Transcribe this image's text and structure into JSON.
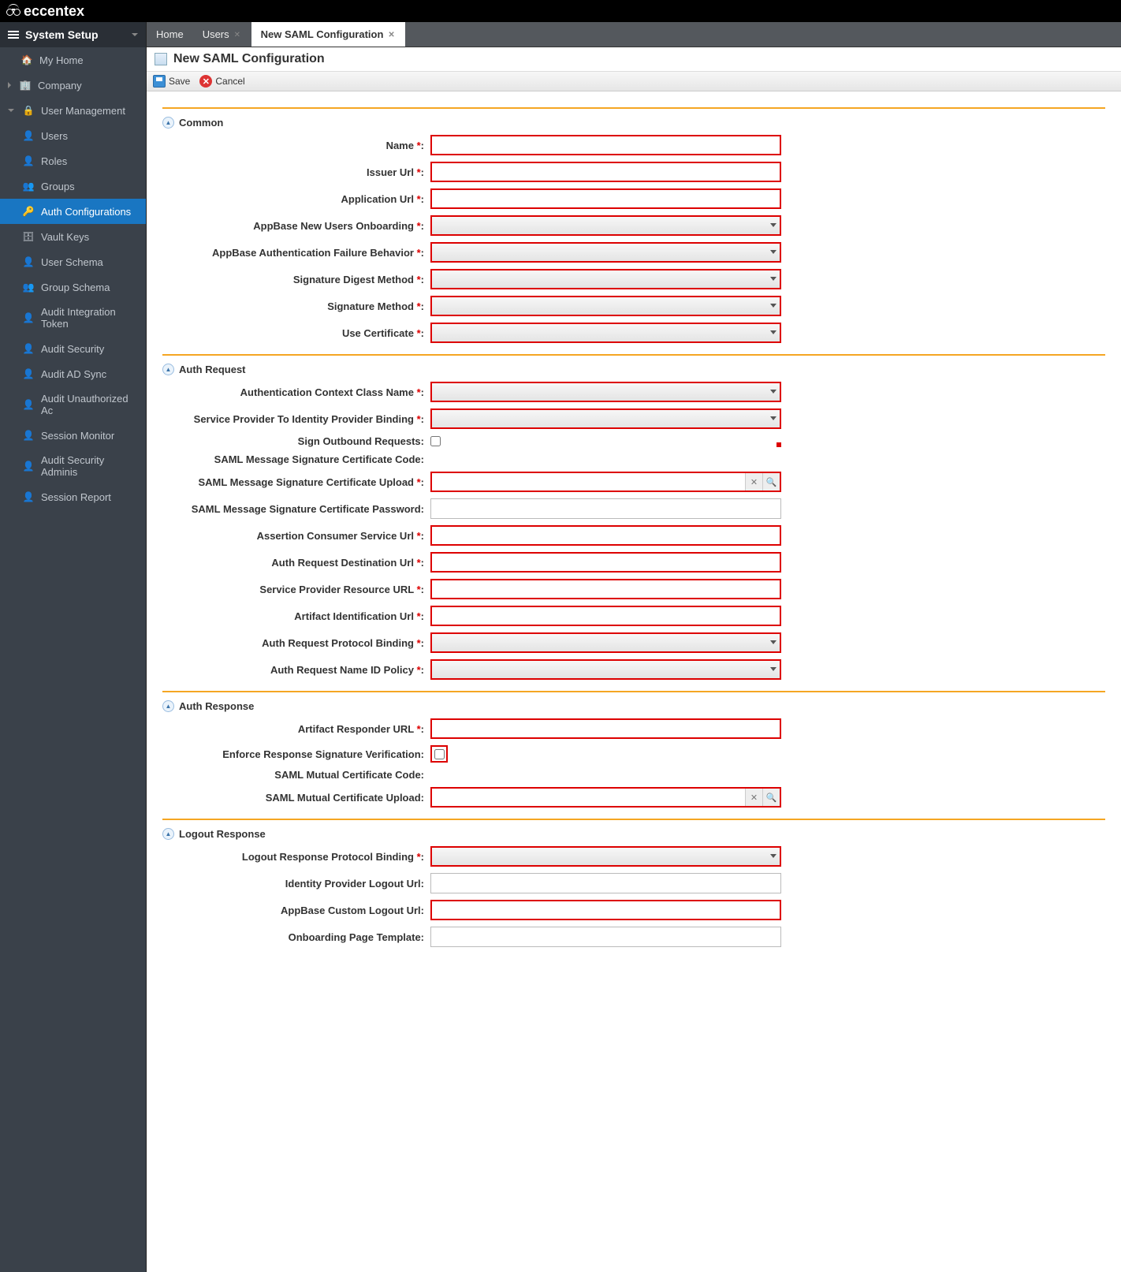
{
  "brand": {
    "name": "eccentex"
  },
  "sidebar": {
    "header": "System Setup",
    "items": [
      {
        "label": "My Home",
        "icon": "home",
        "level": 0
      },
      {
        "label": "Company",
        "icon": "company",
        "level": 0,
        "expandable": true
      },
      {
        "label": "User Management",
        "icon": "lock",
        "level": 0,
        "expandable": true,
        "open": true
      },
      {
        "label": "Users",
        "icon": "user",
        "level": 1
      },
      {
        "label": "Roles",
        "icon": "user",
        "level": 1
      },
      {
        "label": "Groups",
        "icon": "users",
        "level": 1
      },
      {
        "label": "Auth Configurations",
        "icon": "key",
        "level": 1,
        "active": true
      },
      {
        "label": "Vault Keys",
        "icon": "vault",
        "level": 1
      },
      {
        "label": "User Schema",
        "icon": "user",
        "level": 1
      },
      {
        "label": "Group Schema",
        "icon": "users",
        "level": 1
      },
      {
        "label": "Audit Integration Token",
        "icon": "user",
        "level": 1
      },
      {
        "label": "Audit Security",
        "icon": "user",
        "level": 1
      },
      {
        "label": "Audit AD Sync",
        "icon": "user",
        "level": 1
      },
      {
        "label": "Audit Unauthorized Ac",
        "icon": "user",
        "level": 1
      },
      {
        "label": "Session Monitor",
        "icon": "user",
        "level": 1
      },
      {
        "label": "Audit Security Adminis",
        "icon": "user",
        "level": 1
      },
      {
        "label": "Session Report",
        "icon": "user",
        "level": 1
      }
    ]
  },
  "tabs": [
    {
      "label": "Home",
      "closable": false
    },
    {
      "label": "Users",
      "closable": true
    },
    {
      "label": "New SAML Configuration",
      "closable": true,
      "active": true
    }
  ],
  "page": {
    "title": "New SAML Configuration"
  },
  "toolbar": {
    "save": "Save",
    "cancel": "Cancel"
  },
  "sections": {
    "common": {
      "title": "Common",
      "fields": [
        {
          "key": "name",
          "label": "Name",
          "req": true,
          "type": "text"
        },
        {
          "key": "issuer_url",
          "label": "Issuer Url",
          "req": true,
          "type": "text"
        },
        {
          "key": "application_url",
          "label": "Application Url",
          "req": true,
          "type": "text"
        },
        {
          "key": "onboarding",
          "label": "AppBase New Users Onboarding",
          "req": true,
          "type": "select"
        },
        {
          "key": "auth_fail",
          "label": "AppBase Authentication Failure Behavior",
          "req": true,
          "type": "select"
        },
        {
          "key": "sig_digest",
          "label": "Signature Digest Method",
          "req": true,
          "type": "select"
        },
        {
          "key": "sig_method",
          "label": "Signature Method",
          "req": true,
          "type": "select"
        },
        {
          "key": "use_cert",
          "label": "Use Certificate",
          "req": true,
          "type": "select"
        }
      ]
    },
    "auth_request": {
      "title": "Auth Request",
      "fields": [
        {
          "key": "ctx_class",
          "label": "Authentication Context Class Name",
          "req": true,
          "type": "select"
        },
        {
          "key": "sp_idp_binding",
          "label": "Service Provider To Identity Provider Binding",
          "req": true,
          "type": "select"
        },
        {
          "key": "sign_outbound",
          "label": "Sign Outbound Requests:",
          "req": false,
          "type": "checkbox_plain",
          "trail_red": true
        },
        {
          "key": "sig_cert_code",
          "label": "SAML Message Signature Certificate Code:",
          "req": false,
          "type": "static"
        },
        {
          "key": "sig_cert_upload",
          "label": "SAML Message Signature Certificate Upload",
          "req": true,
          "type": "upload"
        },
        {
          "key": "sig_cert_pw",
          "label": "SAML Message Signature Certificate Password:",
          "req": false,
          "type": "text_plain"
        },
        {
          "key": "acs_url",
          "label": "Assertion Consumer Service Url",
          "req": true,
          "type": "text"
        },
        {
          "key": "dest_url",
          "label": "Auth Request Destination Url",
          "req": true,
          "type": "text"
        },
        {
          "key": "sp_res_url",
          "label": "Service Provider Resource URL",
          "req": true,
          "type": "text"
        },
        {
          "key": "artifact_id_url",
          "label": "Artifact Identification Url",
          "req": true,
          "type": "text"
        },
        {
          "key": "protocol_binding",
          "label": "Auth Request Protocol Binding",
          "req": true,
          "type": "select"
        },
        {
          "key": "nameid_policy",
          "label": "Auth Request Name ID Policy",
          "req": true,
          "type": "select"
        }
      ]
    },
    "auth_response": {
      "title": "Auth Response",
      "fields": [
        {
          "key": "artifact_responder",
          "label": "Artifact Responder URL",
          "req": true,
          "type": "text"
        },
        {
          "key": "enforce_sig",
          "label": "Enforce Response Signature Verification:",
          "req": false,
          "type": "checkbox_boxed"
        },
        {
          "key": "mutual_cert_code",
          "label": "SAML Mutual Certificate Code:",
          "req": false,
          "type": "static"
        },
        {
          "key": "mutual_cert_upload",
          "label": "SAML Mutual Certificate Upload:",
          "req": false,
          "type": "upload"
        }
      ]
    },
    "logout_response": {
      "title": "Logout Response",
      "fields": [
        {
          "key": "logout_binding",
          "label": "Logout Response Protocol Binding",
          "req": true,
          "type": "select"
        },
        {
          "key": "idp_logout_url",
          "label": "Identity Provider Logout Url:",
          "req": false,
          "type": "text_plain"
        },
        {
          "key": "custom_logout_url",
          "label": "AppBase Custom Logout Url:",
          "req": false,
          "type": "text"
        },
        {
          "key": "onboard_template",
          "label": "Onboarding Page Template:",
          "req": false,
          "type": "text_plain"
        }
      ]
    }
  }
}
